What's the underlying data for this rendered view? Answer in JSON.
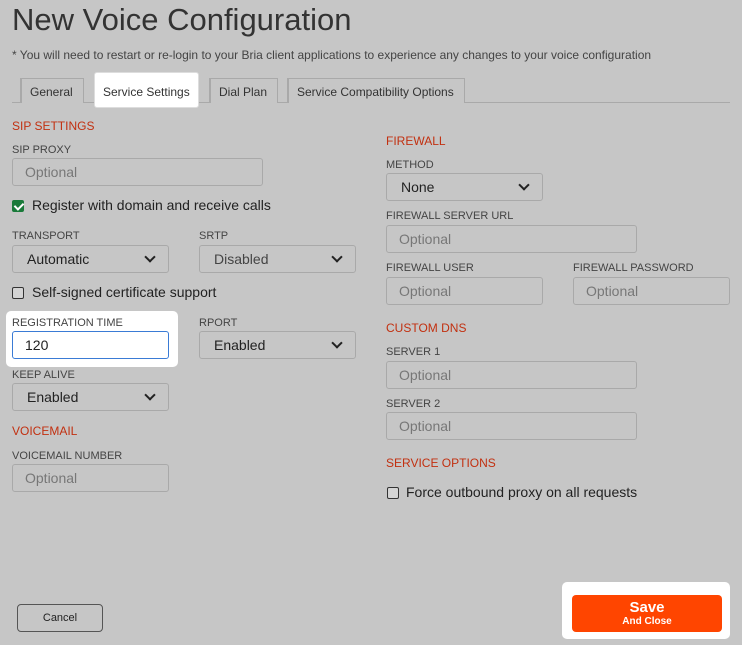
{
  "page": {
    "title": "New Voice Configuration",
    "note": "* You will need to restart or re-login to your Bria client applications to experience any changes to your voice configuration"
  },
  "tabs": [
    {
      "label": "General",
      "active": false
    },
    {
      "label": "Service Settings",
      "active": true
    },
    {
      "label": "Dial Plan",
      "active": false
    },
    {
      "label": "Service Compatibility Options",
      "active": false
    }
  ],
  "sip": {
    "heading": "SIP SETTINGS",
    "proxy_label": "SIP PROXY",
    "proxy_placeholder": "Optional",
    "register_label": "Register with domain and receive calls",
    "register_checked": true,
    "transport_label": "TRANSPORT",
    "transport_value": "Automatic",
    "srtp_label": "SRTP",
    "srtp_value": "Disabled",
    "selfsigned_label": "Self-signed certificate support",
    "selfsigned_checked": false,
    "regtime_label": "REGISTRATION TIME",
    "regtime_value": "120",
    "rport_label": "RPORT",
    "rport_value": "Enabled",
    "keepalive_label": "KEEP ALIVE",
    "keepalive_value": "Enabled"
  },
  "voicemail": {
    "heading": "VOICEMAIL",
    "number_label": "VOICEMAIL NUMBER",
    "number_placeholder": "Optional"
  },
  "firewall": {
    "heading": "FIREWALL",
    "method_label": "METHOD",
    "method_value": "None",
    "server_url_label": "FIREWALL SERVER URL",
    "server_url_placeholder": "Optional",
    "user_label": "FIREWALL USER",
    "user_placeholder": "Optional",
    "password_label": "FIREWALL PASSWORD",
    "password_placeholder": "Optional"
  },
  "dns": {
    "heading": "CUSTOM DNS",
    "server1_label": "SERVER 1",
    "server1_placeholder": "Optional",
    "server2_label": "SERVER 2",
    "server2_placeholder": "Optional"
  },
  "service_options": {
    "heading": "SERVICE OPTIONS",
    "force_proxy_label": "Force outbound proxy on all requests",
    "force_proxy_checked": false
  },
  "footer": {
    "cancel_label": "Cancel",
    "save_label": "Save",
    "save_sub_label": "And Close"
  },
  "colors": {
    "background": "#c6c6c6",
    "section_heading": "#c23010",
    "save_button": "#ff4500",
    "checkbox_checked": "#1a7a3a"
  }
}
